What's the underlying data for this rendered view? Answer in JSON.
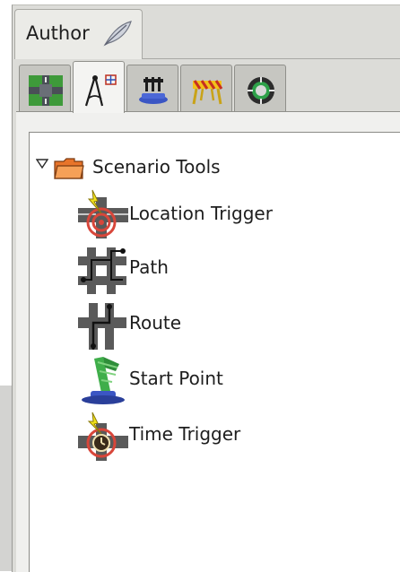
{
  "author_tab": {
    "label": "Author",
    "icon": "feather-icon"
  },
  "tool_tabs": [
    {
      "icon": "road-grid-icon",
      "active": false
    },
    {
      "icon": "drafting-compass-icon",
      "active": true
    },
    {
      "icon": "vehicle-barrier-icon",
      "active": false
    },
    {
      "icon": "construction-barrier-icon",
      "active": false
    },
    {
      "icon": "tire-lifesaver-icon",
      "active": false
    }
  ],
  "tree": {
    "root": {
      "label": "Scenario Tools",
      "icon": "folder-icon",
      "expanded": true
    },
    "items": [
      {
        "label": "Location Trigger",
        "icon": "location-trigger-icon"
      },
      {
        "label": "Path",
        "icon": "path-icon"
      },
      {
        "label": "Route",
        "icon": "route-icon"
      },
      {
        "label": "Start Point",
        "icon": "start-point-icon"
      },
      {
        "label": "Time Trigger",
        "icon": "time-trigger-icon"
      }
    ]
  },
  "colors": {
    "window_bg": "#dcdcd8",
    "tree_bg": "#ffffff",
    "folder_orange": "#e8742a",
    "trigger_yellow": "#f2e21a"
  }
}
